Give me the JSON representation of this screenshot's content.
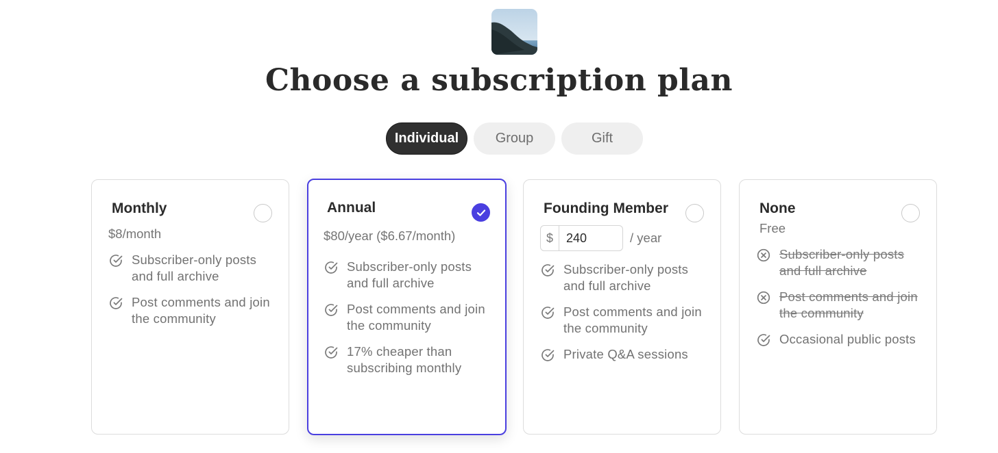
{
  "page": {
    "title": "Choose a subscription plan"
  },
  "tabs": [
    {
      "label": "Individual",
      "active": true
    },
    {
      "label": "Group",
      "active": false
    },
    {
      "label": "Gift",
      "active": false
    }
  ],
  "colors": {
    "accent": "#4a3fe0",
    "active_tab": "#303030",
    "tab_bg": "#efefef"
  },
  "plans": [
    {
      "name": "Monthly",
      "price": "$8/month",
      "selected": false,
      "features": [
        {
          "text": "Subscriber-only posts and full archive",
          "icon": "check-circle-icon",
          "included": true
        },
        {
          "text": "Post comments and join the community",
          "icon": "check-circle-icon",
          "included": true
        }
      ]
    },
    {
      "name": "Annual",
      "price": "$80/year ($6.67/month)",
      "selected": true,
      "features": [
        {
          "text": "Subscriber-only posts and full archive",
          "icon": "check-circle-icon",
          "included": true
        },
        {
          "text": "Post comments and join the community",
          "icon": "check-circle-icon",
          "included": true
        },
        {
          "text": "17% cheaper than subscribing monthly",
          "icon": "check-circle-icon",
          "included": true
        }
      ]
    },
    {
      "name": "Founding Member",
      "currency_symbol": "$",
      "amount": "240",
      "period": "/ year",
      "selected": false,
      "features": [
        {
          "text": "Subscriber-only posts and full archive",
          "icon": "check-circle-icon",
          "included": true
        },
        {
          "text": "Post comments and join the community",
          "icon": "check-circle-icon",
          "included": true
        },
        {
          "text": "Private Q&A sessions",
          "icon": "check-circle-icon",
          "included": true
        }
      ]
    },
    {
      "name": "None",
      "price": "Free",
      "selected": false,
      "features": [
        {
          "text": "Subscriber-only posts and full archive",
          "icon": "x-circle-icon",
          "included": false
        },
        {
          "text": "Post comments and join the community",
          "icon": "x-circle-icon",
          "included": false
        },
        {
          "text": "Occasional public posts",
          "icon": "check-circle-icon",
          "included": true
        }
      ]
    }
  ]
}
